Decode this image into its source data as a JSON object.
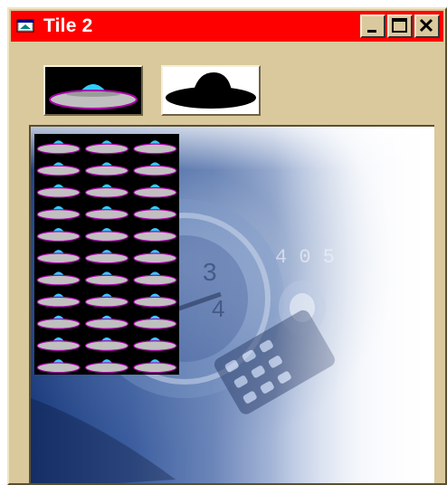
{
  "window": {
    "title": "Tile 2",
    "title_bar_color": "#ff0000",
    "face_color": "#dac99d",
    "icons": {
      "app": "window-app-icon",
      "minimize": "minimize-icon",
      "maximize": "maximize-icon",
      "close": "close-icon"
    }
  },
  "sprites": {
    "sprite_icon": "ufo-sprite-icon",
    "mask_icon": "ufo-mask-icon",
    "ufo_dome_color": "#33ccff",
    "ufo_body_color": "#c0c0c0",
    "ufo_rim_color": "#aa00aa"
  },
  "picture": {
    "background_icon": "blue-gadgets-background",
    "tile_grid": {
      "columns": 3,
      "rows": 11,
      "tile_icon": "ufo-tile-icon"
    }
  }
}
